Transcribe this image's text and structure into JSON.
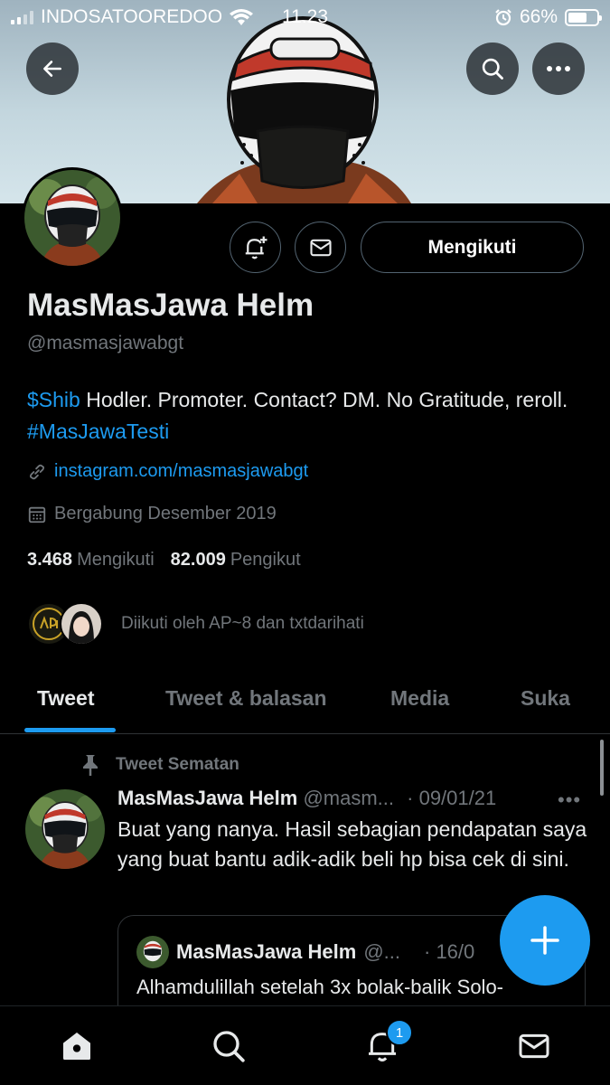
{
  "status_bar": {
    "carrier": "INDOSATOOREDOO",
    "time": "11.23",
    "battery": "66%",
    "battery_level": 0.66
  },
  "header": {
    "back_icon": "arrow-left-icon",
    "search_icon": "search-icon",
    "more_icon": "more-horizontal-icon"
  },
  "profile": {
    "name": "MasMasJawa Helm",
    "handle": "@masmasjawabgt",
    "bio": {
      "cashtag": "$Shib",
      "text": " Hodler. Promoter. Contact? DM. No Gratitude, reroll. ",
      "hashtag": "#MasJawaTesti"
    },
    "website": "instagram.com/masmasjawabgt",
    "joined": "Bergabung Desember 2019",
    "following_count": "3.468",
    "following_label": "Mengikuti",
    "followers_count": "82.009",
    "followers_label": "Pengikut",
    "followed_by": "Diikuti oleh AP~8 dan txtdarihati",
    "follow_button": "Mengikuti"
  },
  "tabs": [
    {
      "label": "Tweet",
      "active": true
    },
    {
      "label": "Tweet & balasan",
      "active": false
    },
    {
      "label": "Media",
      "active": false
    },
    {
      "label": "Suka",
      "active": false
    }
  ],
  "pinned_tweet": {
    "pin_label": "Tweet Sematan",
    "name": "MasMasJawa Helm",
    "handle": "@masm...",
    "date": "· 09/01/21",
    "more": "•••",
    "text": "Buat yang nanya. Hasil sebagian pendapatan saya yang buat bantu adik-adik beli hp bisa cek di sini.",
    "quote": {
      "name": "MasMasJawa Helm",
      "handle": "@...",
      "date": "· 16/0",
      "text": "Alhamdulillah setelah 3x bolak-balik Solo-"
    }
  },
  "bottom_nav": {
    "notifications_badge": "1"
  },
  "colors": {
    "accent": "#1d9bf0",
    "background": "#000000",
    "muted": "#71767b",
    "text": "#e7e9ea"
  }
}
